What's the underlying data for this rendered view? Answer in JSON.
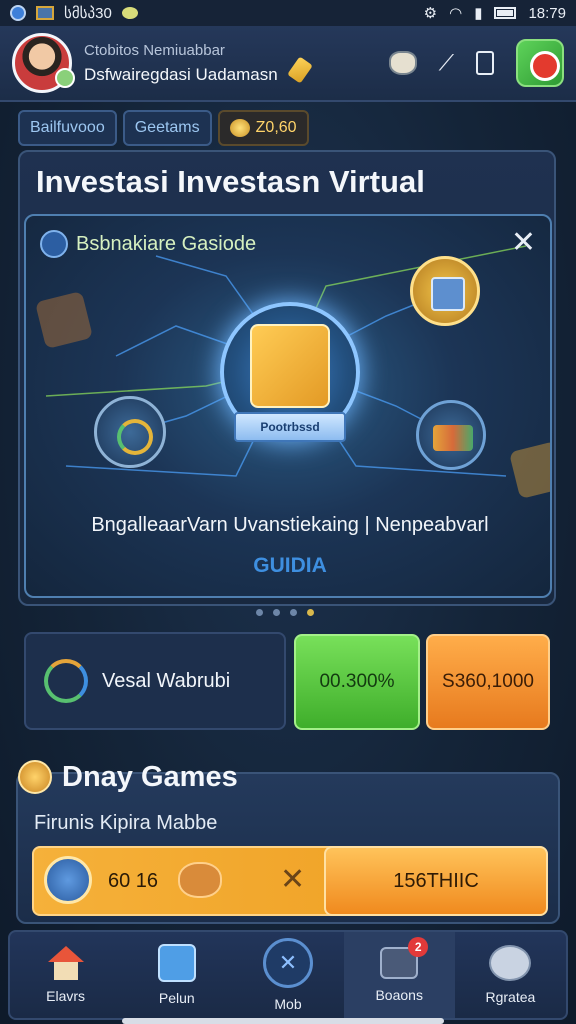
{
  "status_bar": {
    "carrier": "სმსპ30",
    "time": "18:79"
  },
  "profile": {
    "subtitle": "Ctobitos Nemiuabbar",
    "name": "Dsfwairegdasi Uadamasn"
  },
  "chips": [
    {
      "label": "Bailfuvooo"
    },
    {
      "label": "Geetams"
    },
    {
      "label": "Z0,60"
    }
  ],
  "main_card": {
    "title": "Investasi Investasn Virtual",
    "inner": {
      "heading": "Bsbnakiare Gasiode",
      "badge_text": "Pootrbssd",
      "description": "BngalleaarVarn Uvanstiekaing | Nenpeabvarl",
      "cta": "GUIDIA"
    }
  },
  "pager": {
    "count": 4,
    "active_index": 3
  },
  "stats": {
    "label": "Vesal Wabrubi",
    "green_value": "00.300%",
    "orange_value": "S360,1000"
  },
  "daily_games": {
    "title": "Dnay Games",
    "subtitle": "Firunis Kipira Mabbe",
    "reward_value": "60 16",
    "claim_label": "156THIIC"
  },
  "bottom_nav": [
    {
      "label": "Elavrs",
      "icon": "home-icon"
    },
    {
      "label": "Pelun",
      "icon": "house-icon"
    },
    {
      "label": "Mob",
      "icon": "mob-icon"
    },
    {
      "label": "Boaons",
      "icon": "chat-icon",
      "badge": "2"
    },
    {
      "label": "Rgratea",
      "icon": "paw-icon"
    }
  ],
  "colors": {
    "accent_green": "#4fc238",
    "accent_orange": "#f08a1e",
    "accent_blue": "#3e8fe0",
    "background": "#142438"
  }
}
